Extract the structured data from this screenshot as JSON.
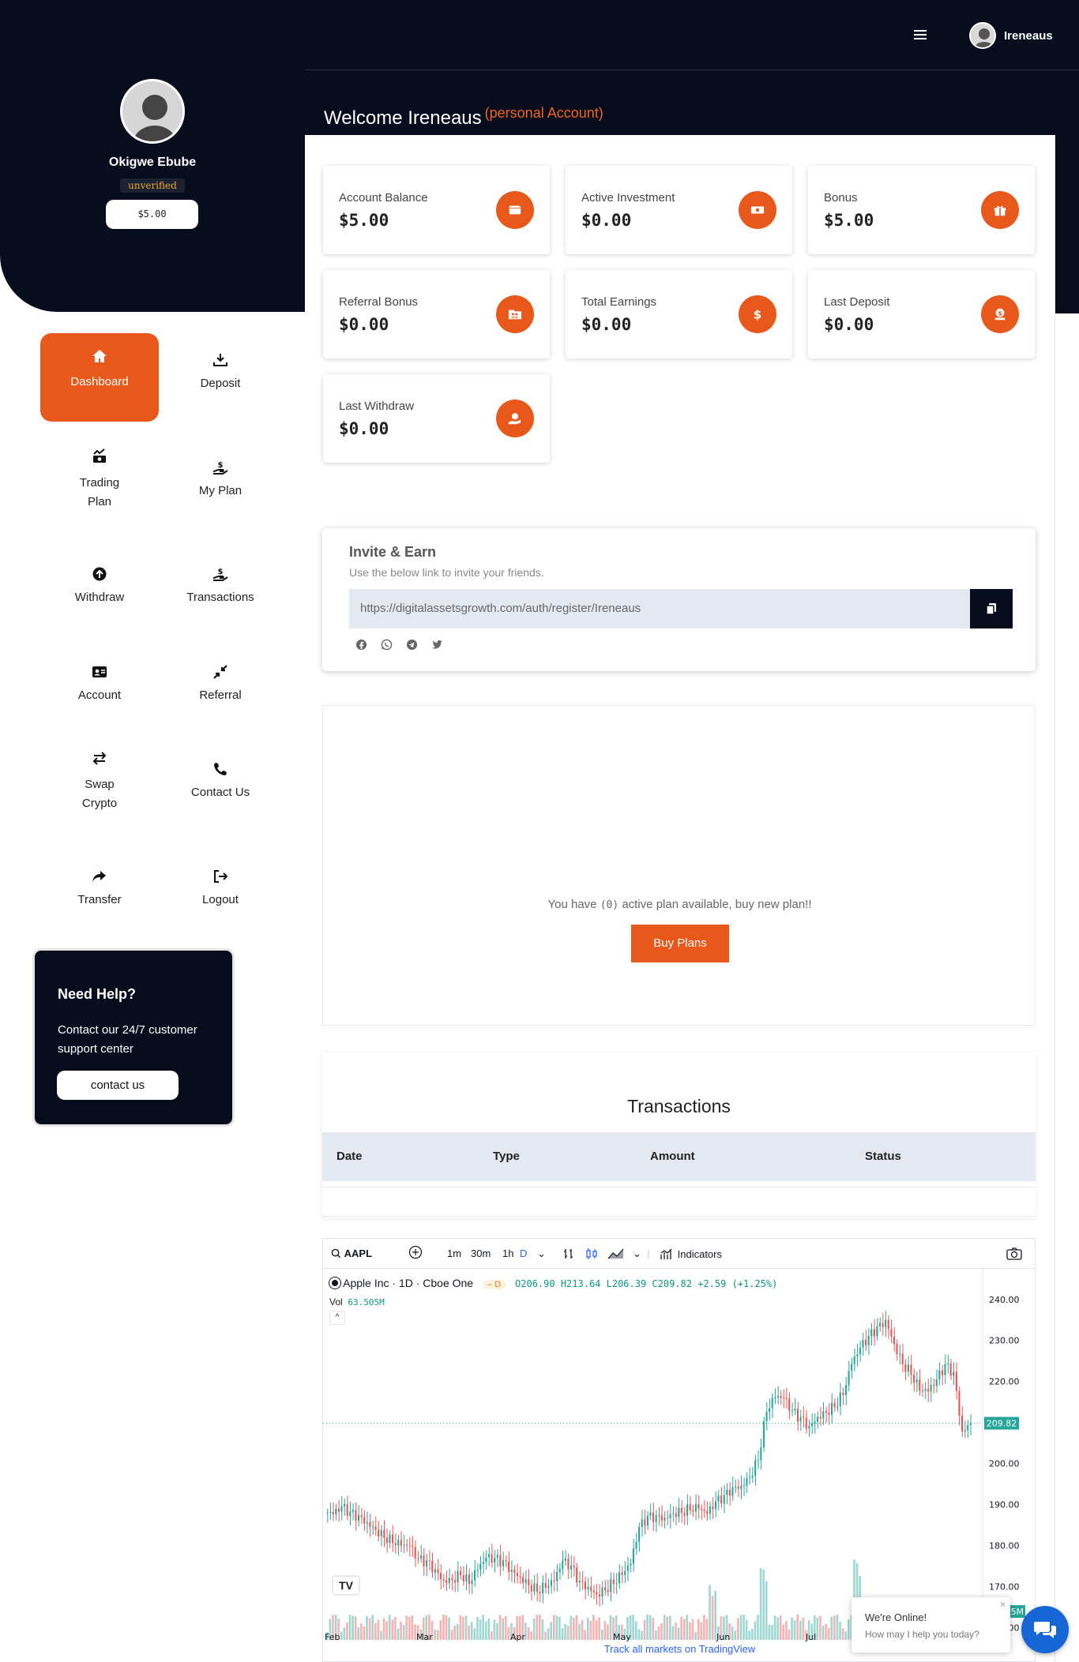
{
  "header": {
    "username": "Ireneaus",
    "welcome": "Welcome Ireneaus",
    "account_type": "(personal Account)"
  },
  "profile": {
    "name": "Okigwe Ebube",
    "status": "unverified",
    "balance": "$5.00"
  },
  "menu": [
    {
      "label": "Dashboard",
      "icon": "home-icon",
      "active": true
    },
    {
      "label": "Deposit",
      "icon": "download-icon"
    },
    {
      "label": "Trading Plan",
      "icon": "money-growth-icon"
    },
    {
      "label": "My Plan",
      "icon": "hand-dollar-icon"
    },
    {
      "label": "Withdraw",
      "icon": "arrow-up-circle-icon"
    },
    {
      "label": "Transactions",
      "icon": "hand-dollar-icon"
    },
    {
      "label": "Account",
      "icon": "id-card-icon"
    },
    {
      "label": "Referral",
      "icon": "compress-icon"
    },
    {
      "label": "Swap Crypto",
      "icon": "swap-icon"
    },
    {
      "label": "Contact Us",
      "icon": "phone-icon"
    },
    {
      "label": "Transfer",
      "icon": "share-icon"
    },
    {
      "label": "Logout",
      "icon": "logout-icon"
    }
  ],
  "help": {
    "title": "Need Help?",
    "text": "Contact our 24/7 customer support center",
    "button": "contact us"
  },
  "stats": [
    {
      "label": "Account Balance",
      "value": "$5.00",
      "icon": "wallet-icon"
    },
    {
      "label": "Active Investment",
      "value": "$0.00",
      "icon": "cash-icon"
    },
    {
      "label": "Bonus",
      "value": "$5.00",
      "icon": "gift-icon"
    },
    {
      "label": "Referral Bonus",
      "value": "$0.00",
      "icon": "folder-users-icon"
    },
    {
      "label": "Total Earnings",
      "value": "$0.00",
      "icon": "dollar-icon"
    },
    {
      "label": "Last Deposit",
      "value": "$0.00",
      "icon": "deposit-icon"
    },
    {
      "label": "Last Withdraw",
      "value": "$0.00",
      "icon": "withdraw-hand-icon"
    }
  ],
  "invite": {
    "title": "Invite & Earn",
    "subtitle": "Use the below link to invite your friends.",
    "link": "https://digitalassetsgrowth.com/auth/register/Ireneaus",
    "social": [
      "facebook-icon",
      "whatsapp-icon",
      "telegram-icon",
      "twitter-icon"
    ]
  },
  "plans": {
    "text_before": "You have",
    "count": "(0)",
    "text_after": "active plan available, buy new plan!!",
    "button": "Buy Plans"
  },
  "transactions": {
    "title": "Transactions",
    "columns": [
      "Date",
      "Type",
      "Amount",
      "Status"
    ],
    "rows": []
  },
  "chart_widget": {
    "symbol": "AAPL",
    "intervals": [
      "1m",
      "30m",
      "1h",
      "D"
    ],
    "indicators_label": "Indicators",
    "legend_name": "Apple Inc · 1D · Cboe One",
    "legend_badge": "D",
    "ohlc": "O206.90 H213.64 L206.39 C209.82 +2.59 (+1.25%)",
    "vol_label": "Vol",
    "vol_value": "63.505M",
    "last_price_tag": "209.82",
    "volume_tag": "63.505M",
    "logo": "TV",
    "footer": "Track all markets on TradingView",
    "colors": {
      "up": "#26a69a",
      "down": "#ef5350"
    }
  },
  "chart_data": {
    "type": "candlestick",
    "title": "Apple Inc · 1D · Cboe One",
    "x_labels": [
      "Feb",
      "Mar",
      "Apr",
      "May",
      "Jun",
      "Jul"
    ],
    "y_ticks": [
      160.0,
      170.0,
      180.0,
      190.0,
      200.0,
      210.0,
      220.0,
      230.0,
      240.0
    ],
    "ylim": [
      157,
      244
    ],
    "last_close": 209.82,
    "close_path": [
      188,
      189,
      187,
      186,
      185,
      184,
      183,
      182,
      181,
      180,
      176,
      175,
      173,
      171,
      172,
      174,
      172,
      175,
      177,
      176,
      175,
      173,
      172,
      171,
      170,
      171,
      172,
      176,
      174,
      170,
      169,
      168,
      170,
      172,
      174,
      176,
      184,
      186,
      186,
      186,
      188,
      189,
      190,
      190,
      188,
      190,
      191,
      193,
      194,
      197,
      202,
      214,
      217,
      216,
      212,
      210,
      208,
      211,
      213,
      215,
      218,
      225,
      228,
      230,
      232,
      234,
      229,
      225,
      223,
      219,
      218,
      220,
      223,
      221,
      207,
      210
    ]
  },
  "chat": {
    "title": "We're Online!",
    "subtitle": "How may I help you today?"
  }
}
